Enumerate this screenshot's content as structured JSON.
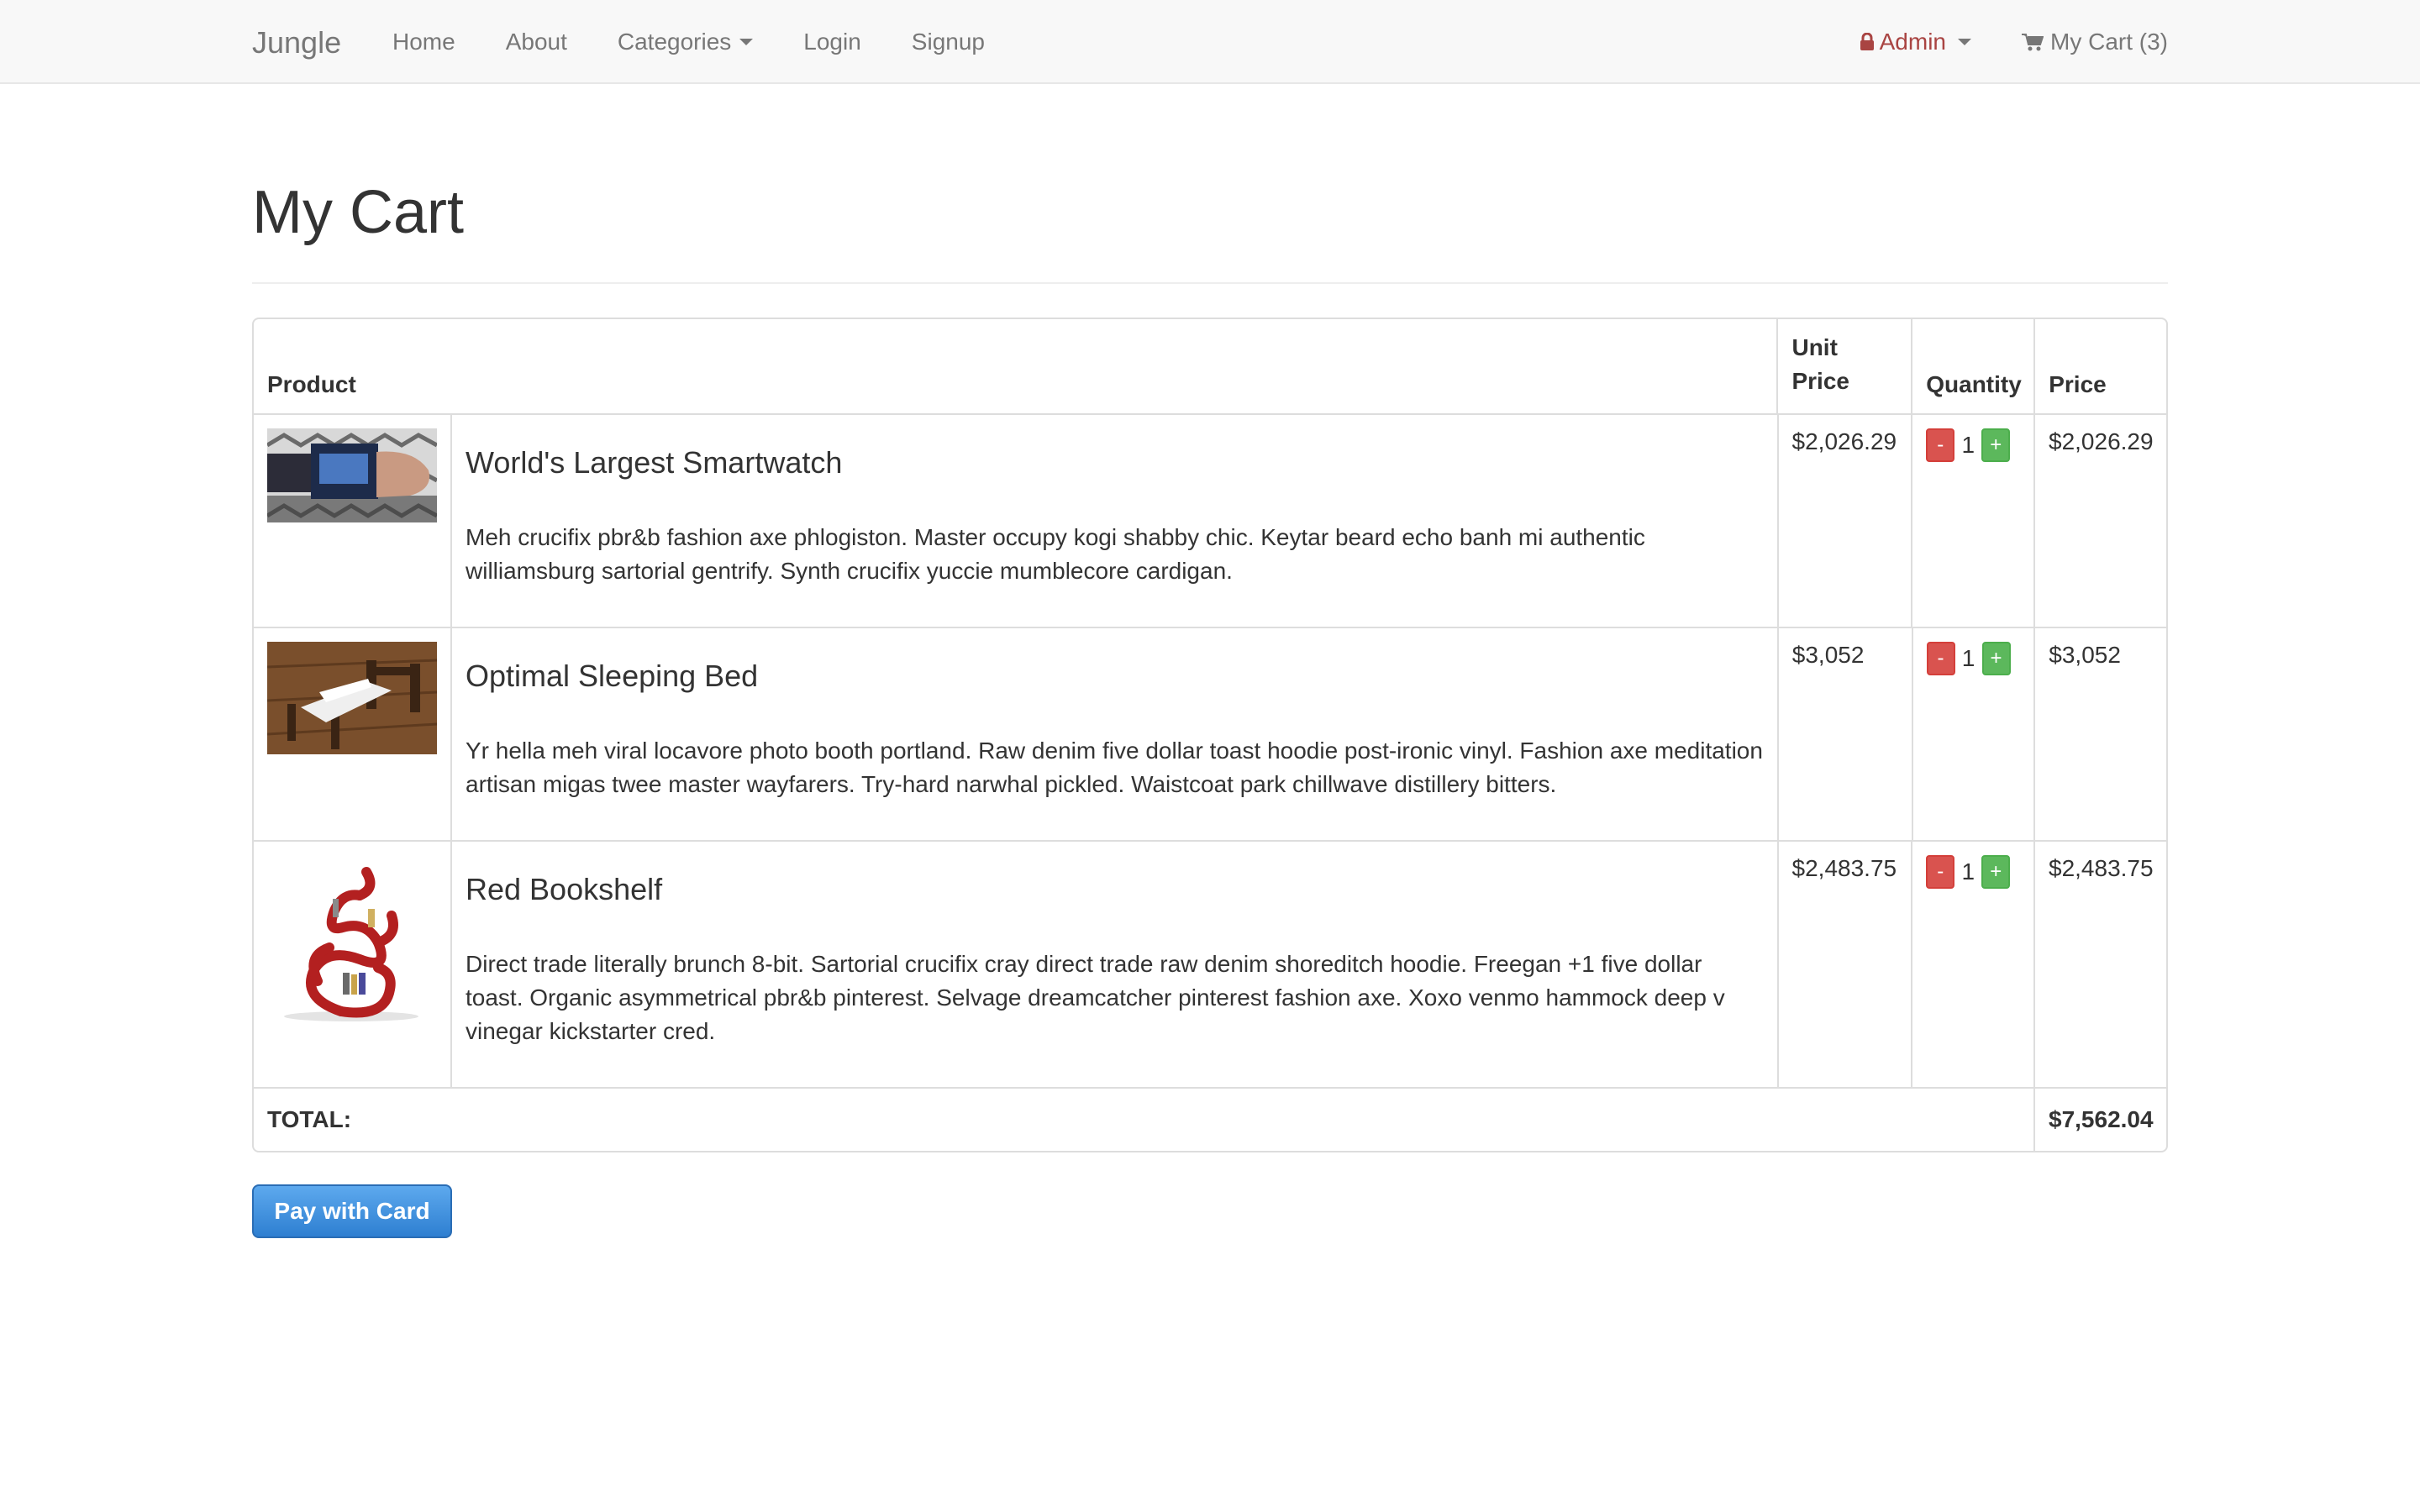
{
  "nav": {
    "brand": "Jungle",
    "links": [
      "Home",
      "About",
      "Categories",
      "Login",
      "Signup"
    ],
    "admin": "Admin",
    "cart": "My Cart (3)"
  },
  "page": {
    "title": "My Cart"
  },
  "table": {
    "headers": {
      "product": "Product",
      "unit_price": "Unit Price",
      "quantity": "Quantity",
      "price": "Price"
    },
    "items": [
      {
        "name": "World's Largest Smartwatch",
        "description": "Meh crucifix pbr&b fashion axe phlogiston. Master occupy kogi shabby chic. Keytar beard echo banh mi authentic williamsburg sartorial gentrify. Synth crucifix yuccie mumblecore cardigan.",
        "unit_price": "$2,026.29",
        "quantity": "1",
        "price": "$2,026.29",
        "image": "smartwatch-image"
      },
      {
        "name": "Optimal Sleeping Bed",
        "description": "Yr hella meh viral locavore photo booth portland. Raw denim five dollar toast hoodie post-ironic vinyl. Fashion axe meditation artisan migas twee master wayfarers. Try-hard narwhal pickled. Waistcoat park chillwave distillery bitters.",
        "unit_price": "$3,052",
        "quantity": "1",
        "price": "$3,052",
        "image": "bed-image"
      },
      {
        "name": "Red Bookshelf",
        "description": "Direct trade literally brunch 8-bit. Sartorial crucifix cray direct trade raw denim shoreditch hoodie. Freegan +1 five dollar toast. Organic asymmetrical pbr&b pinterest. Selvage dreamcatcher pinterest fashion axe. Xoxo venmo hammock deep v vinegar kickstarter cred.",
        "unit_price": "$2,483.75",
        "quantity": "1",
        "price": "$2,483.75",
        "image": "bookshelf-image"
      }
    ],
    "minus_label": "-",
    "plus_label": "+",
    "total_label": "TOTAL:",
    "total_value": "$7,562.04"
  },
  "pay_button": "Pay with Card",
  "colors": {
    "navbar_bg": "#f8f8f8",
    "admin_red": "#a94442",
    "minus_red": "#d9534f",
    "plus_green": "#5cb85c",
    "pay_blue": "#3a8ee6"
  }
}
